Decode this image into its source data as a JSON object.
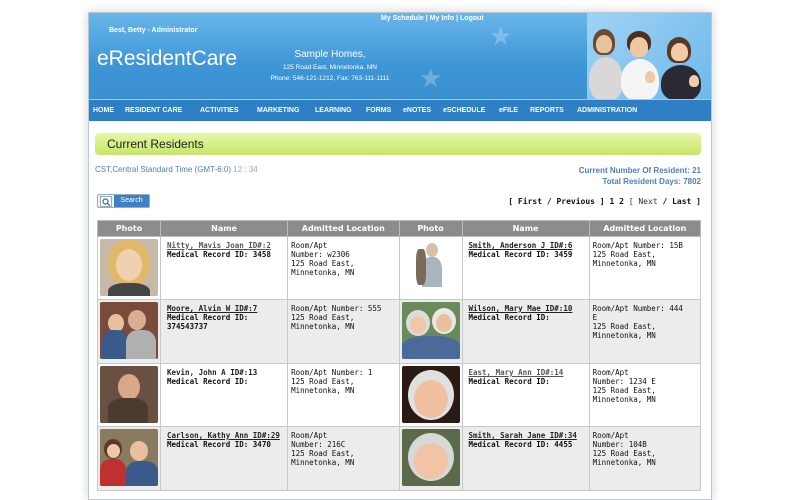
{
  "header": {
    "user": "Best, Betty - Administrator",
    "logo": "eResidentCare",
    "top_links": [
      "My Schedule",
      "My Info",
      "Logout"
    ],
    "facility_name": "Sample Homes,",
    "facility_address": "125 Road East, Minnetonka, MN",
    "facility_phone": "Phone: 546-121-1212, Fax: 763-111-1111"
  },
  "nav": [
    "HOME",
    "RESIDENT CARE",
    "ACTIVITIES",
    "MARKETING",
    "LEARNING",
    "FORMS",
    "eNOTES",
    "eSCHEDULE",
    "eFILE",
    "REPORTS",
    "ADMINISTRATION"
  ],
  "page": {
    "title": "Current Residents",
    "timezone": "CST,Central Standard Time (GMT-6:0)",
    "clock": "12 : 34",
    "current_count": "Current Number Of Resident: 21",
    "total_days": "Total Resident Days: 7802",
    "search_label": "Search",
    "pager": {
      "first_prev": "[ First / Previous ]",
      "pages": "1 2",
      "next_last_open": "[ Next",
      "next_last_close": "/ Last ]"
    }
  },
  "table": {
    "headers": [
      "Photo",
      "Name",
      "Admitted Location",
      "Photo",
      "Name",
      "Admitted Location"
    ],
    "rows": [
      {
        "left": {
          "name": "Nitty, Mavis Joan ID#:2",
          "medrec": "Medical Record ID:  3458",
          "loc": [
            "Room/Apt",
            "Number: w2306",
            "125 Road East,",
            "Minnetonka, MN"
          ]
        },
        "right": {
          "name": "Smith, Anderson J ID#:6",
          "medrec": "Medical Record ID:  3459",
          "loc": [
            "Room/Apt Number: 15B",
            "125 Road East,",
            "Minnetonka, MN"
          ]
        }
      },
      {
        "left": {
          "name": "Moore, Alvin W ID#:7",
          "medrec": "Medical Record ID: 374543737",
          "loc": [
            "Room/Apt Number: 555",
            "125 Road East,",
            "Minnetonka, MN"
          ]
        },
        "right": {
          "name": "Wilson, Mary Mae ID#:10",
          "medrec": "Medical Record ID:",
          "loc": [
            "Room/Apt Number: 444",
            "E",
            "125 Road East,",
            "Minnetonka, MN"
          ]
        }
      },
      {
        "left": {
          "name": "Kevin, John A ID#:13",
          "medrec": "Medical Record ID:",
          "loc": [
            "Room/Apt Number: 1",
            "125 Road East,",
            "Minnetonka, MN"
          ]
        },
        "right": {
          "name": "East, Mary Ann ID#:14",
          "medrec": "Medical Record ID:",
          "loc": [
            "Room/Apt",
            "Number: 1234 E",
            "125 Road East,",
            "Minnetonka, MN"
          ]
        }
      },
      {
        "left": {
          "name": "Carlson, Kathy Ann ID#:29",
          "medrec": "Medical Record ID:  3470",
          "loc": [
            "Room/Apt",
            "Number: 216C",
            "125 Road East,",
            "Minnetonka, MN"
          ]
        },
        "right": {
          "name": "Smith, Sarah Jane ID#:34",
          "medrec": "Medical Record ID:  4455",
          "loc": [
            "Room/Apt",
            "Number: 104B",
            "125 Road East,",
            "Minnetonka, MN"
          ]
        }
      }
    ]
  },
  "colors": {
    "header_blue": "#3e96d6",
    "nav_blue": "#2f7fc5",
    "title_green": "#c6e56a",
    "link_blue": "#4f7fb7",
    "table_header": "#8c8c8c"
  }
}
